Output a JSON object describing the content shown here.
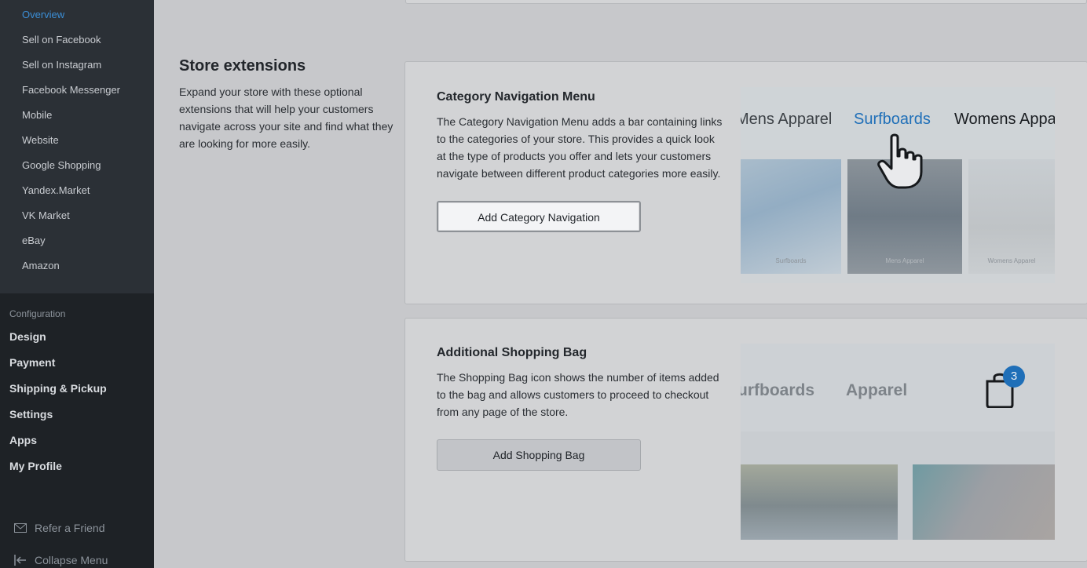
{
  "sidebar": {
    "sub_items": [
      {
        "label": "Overview",
        "active": true
      },
      {
        "label": "Sell on Facebook"
      },
      {
        "label": "Sell on Instagram"
      },
      {
        "label": "Facebook Messenger"
      },
      {
        "label": "Mobile"
      },
      {
        "label": "Website"
      },
      {
        "label": "Google Shopping"
      },
      {
        "label": "Yandex.Market"
      },
      {
        "label": "VK Market"
      },
      {
        "label": "eBay"
      },
      {
        "label": "Amazon"
      }
    ],
    "config_label": "Configuration",
    "main_items": [
      "Design",
      "Payment",
      "Shipping & Pickup",
      "Settings",
      "Apps",
      "My Profile"
    ],
    "refer": "Refer a Friend",
    "collapse": "Collapse Menu"
  },
  "section": {
    "title": "Store extensions",
    "description": "Expand your store with these optional extensions that will help your customers navigate across your site and find what they are looking for more easily."
  },
  "category_nav": {
    "title": "Category Navigation Menu",
    "description": "The Category Navigation Menu adds a bar containing links to the categories of your store. This provides a quick look at the type of products you offer and lets your customers navigate between different product categories more easily.",
    "button": "Add Category Navigation",
    "preview": {
      "nav_items": [
        "Mens Apparel",
        "Surfboards",
        "Womens Appa"
      ],
      "tiles": [
        "Surfboards",
        "Mens Apparel",
        "Womens Apparel"
      ]
    }
  },
  "shopping_bag": {
    "title": "Additional Shopping Bag",
    "description": "The Shopping Bag icon shows the number of items added to the bag and allows customers to proceed to checkout from any page of the store.",
    "button": "Add Shopping Bag",
    "preview": {
      "nav_items": [
        "urfboards",
        "Apparel"
      ],
      "badge_count": "3"
    }
  },
  "colors": {
    "accent": "#1f6fb8",
    "sidebar_active": "#3b8ed6"
  }
}
